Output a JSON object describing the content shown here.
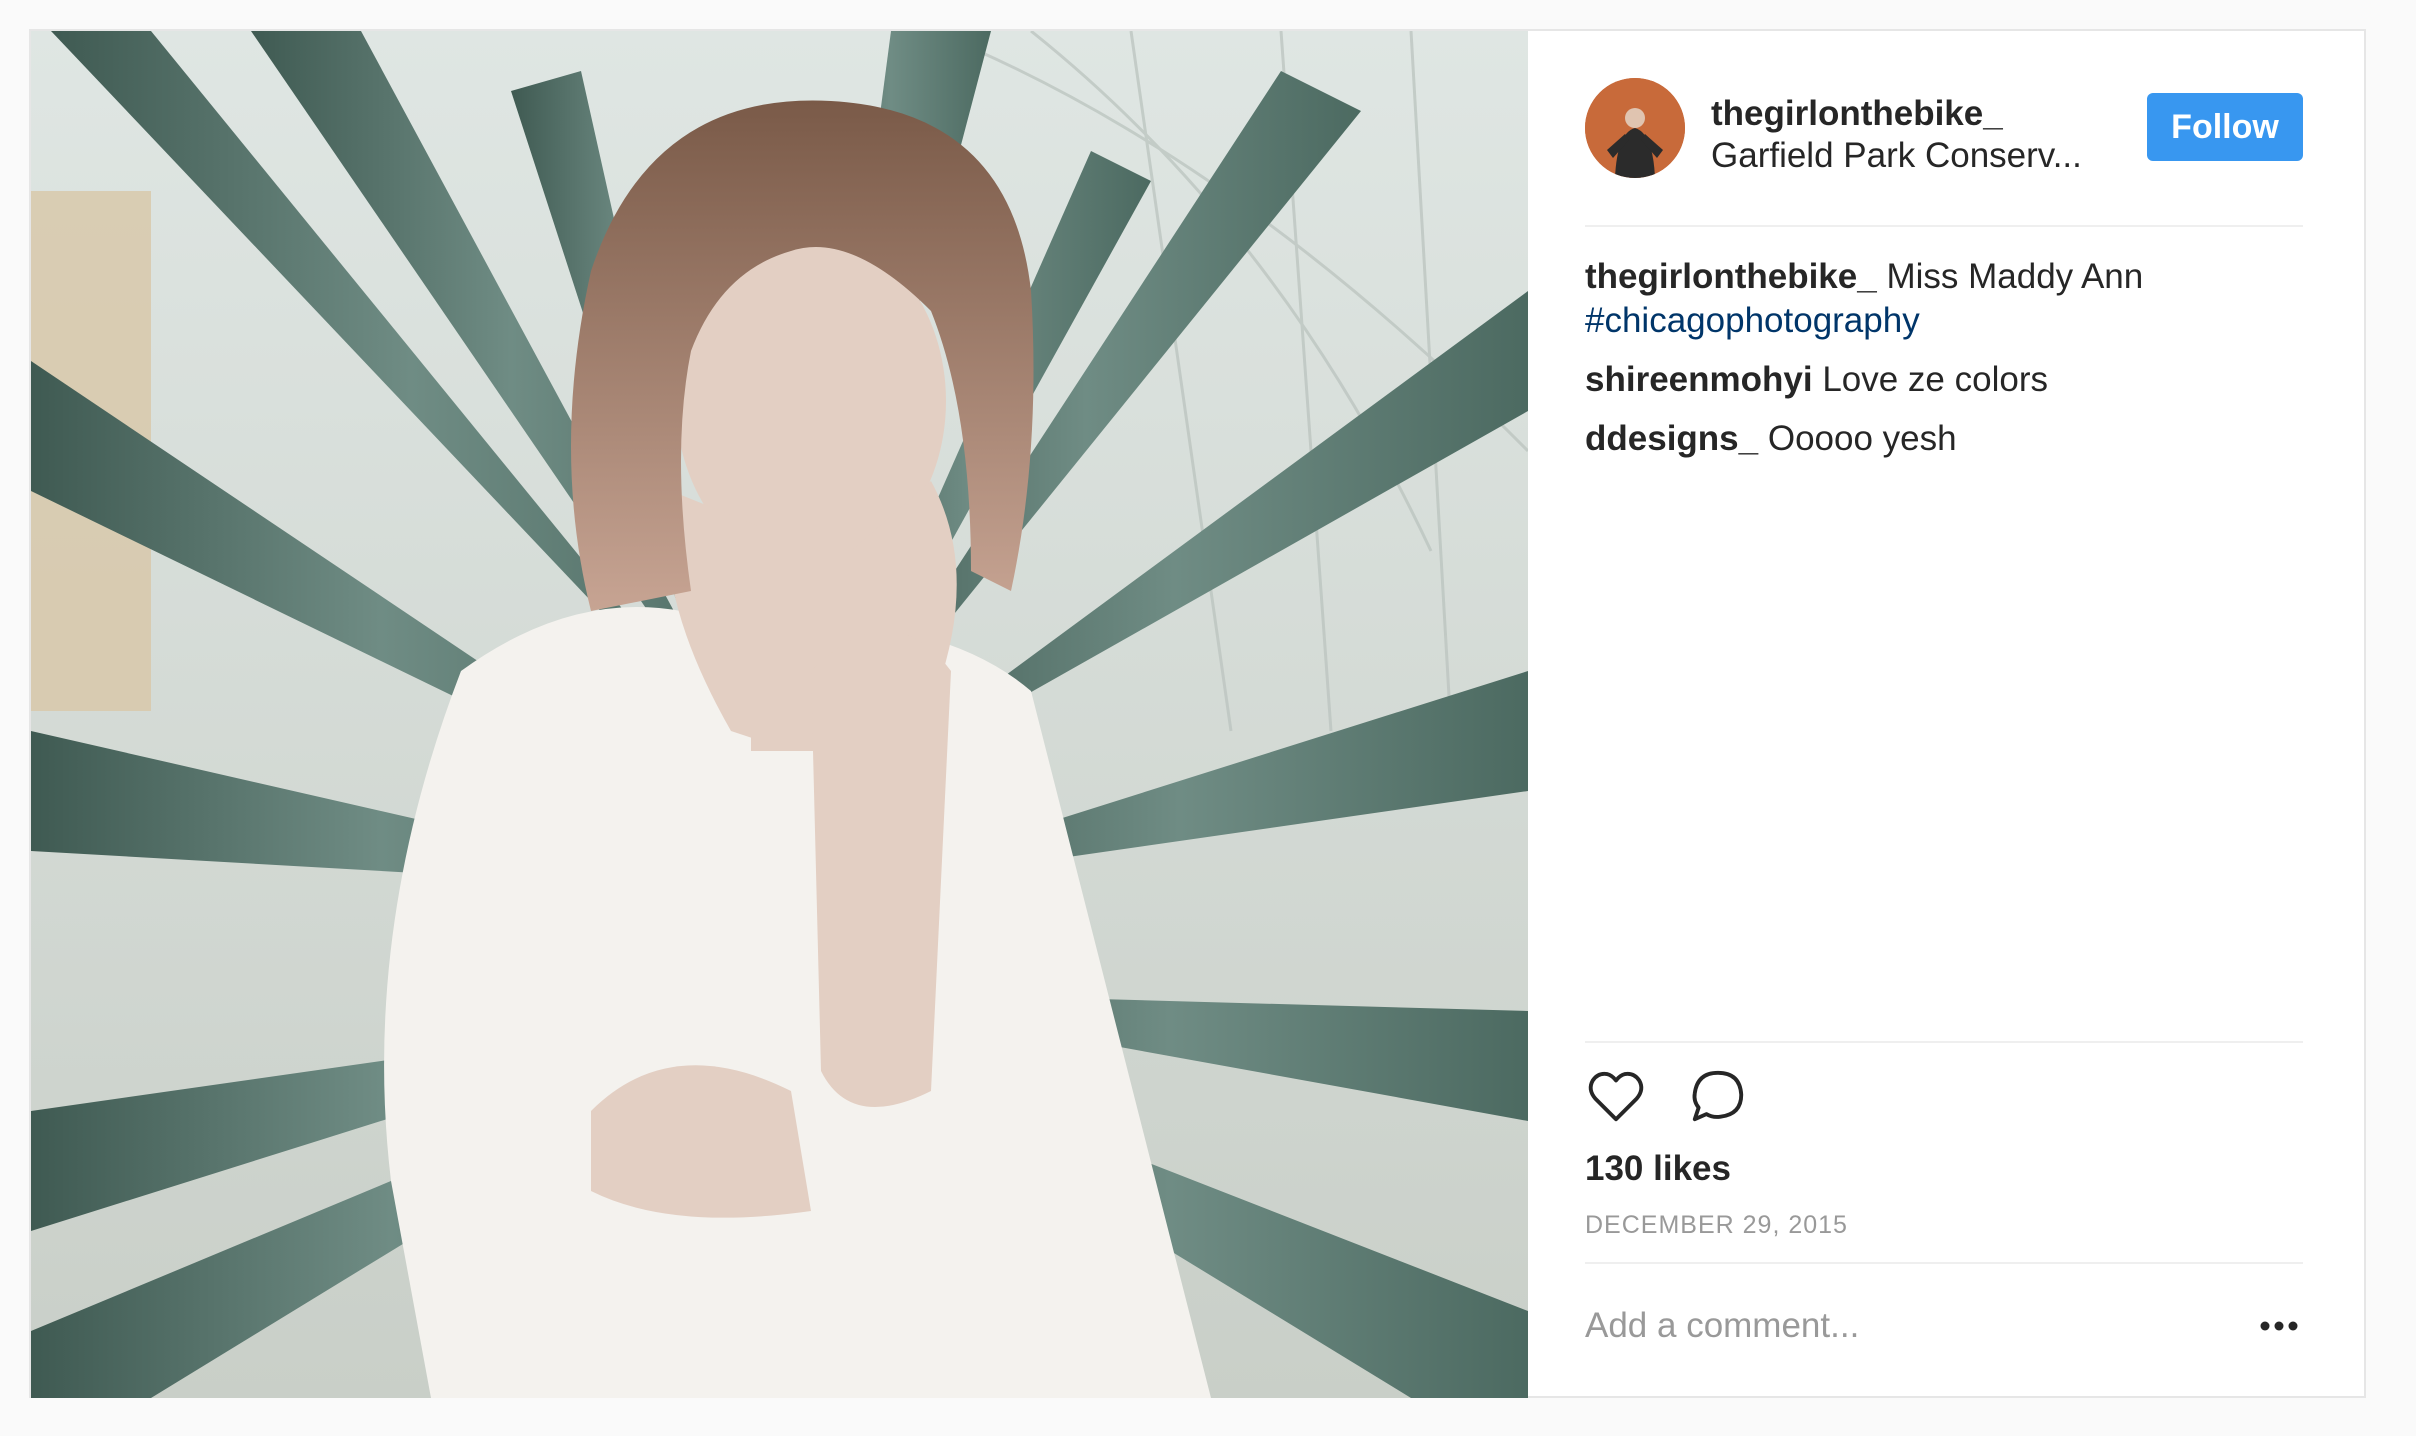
{
  "post": {
    "username": "thegirlonthebike_",
    "location": "Garfield Park Conserv...",
    "follow_label": "Follow",
    "caption": {
      "user": "thegirlonthebike_",
      "text": "Miss Maddy Ann",
      "hashtag": "#chicagophotography"
    },
    "comments": [
      {
        "user": "shireenmohyi",
        "text": "Love ze colors"
      },
      {
        "user": "ddesigns_",
        "text": "Ooooo yesh"
      }
    ],
    "likes": "130 likes",
    "date": "DECEMBER 29, 2015",
    "add_comment_placeholder": "Add a comment..."
  },
  "icons": [
    "heart-icon",
    "comment-icon",
    "more-options-icon"
  ],
  "colors": {
    "follow_button": "#3897f0",
    "hashtag": "#003569",
    "muted": "#999999",
    "text": "#262626"
  }
}
